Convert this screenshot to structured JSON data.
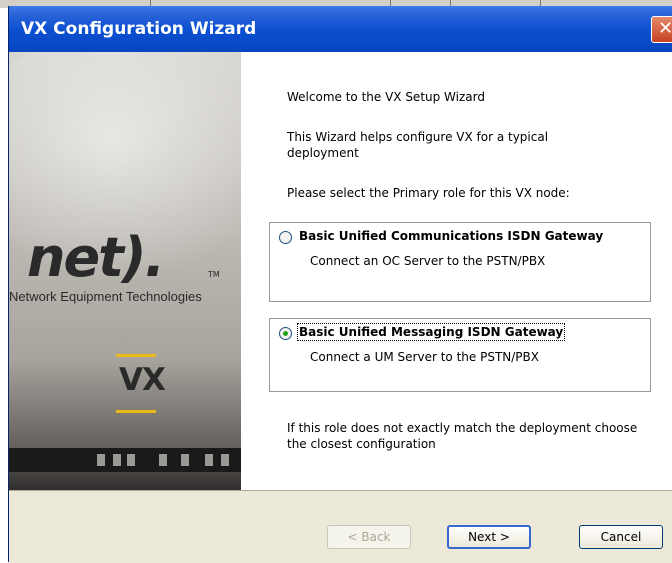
{
  "window": {
    "title": "VX Configuration Wizard",
    "close_glyph": "✕"
  },
  "banner": {
    "logo_text": "net",
    "logo_mark": ").",
    "trademark": "TM",
    "tagline": "Network Equipment Technologies",
    "product_mark": "VX"
  },
  "content": {
    "welcome": "Welcome to the VX Setup Wizard",
    "intro": "This Wizard helps configure VX for a typical deployment",
    "prompt": "Please select the Primary role for this VX node:",
    "options": [
      {
        "label": "Basic Unified Communications ISDN Gateway",
        "description": "Connect an OC Server to the PSTN/PBX",
        "selected": false
      },
      {
        "label": "Basic Unified Messaging ISDN Gateway",
        "description": "Connect a UM Server to the PSTN/PBX",
        "selected": true
      }
    ],
    "note": "If this role does not exactly match the deployment choose the closest configuration"
  },
  "buttons": {
    "back": "< Back",
    "next": "Next >",
    "cancel": "Cancel"
  },
  "colors": {
    "title_bar": "#0a4fd0",
    "accent_line": "#e8b917",
    "radio_dot": "#21a121"
  }
}
